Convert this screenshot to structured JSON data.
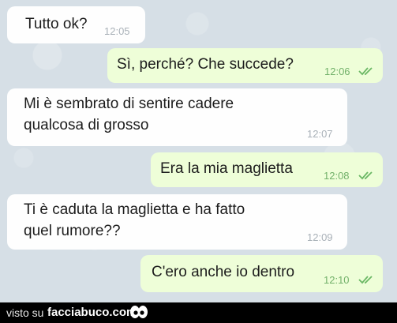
{
  "messages": [
    {
      "type": "incoming",
      "lines": [
        "Tutto ok?"
      ],
      "time": "12:05"
    },
    {
      "type": "outgoing",
      "lines": [
        "Sì, perché? Che succede?"
      ],
      "time": "12:06",
      "read_icon": "double-check-icon"
    },
    {
      "type": "incoming",
      "lines": [
        "Mi è sembrato di sentire cadere",
        "qualcosa di grosso"
      ],
      "time": "12:07"
    },
    {
      "type": "outgoing",
      "lines": [
        "Era la mia maglietta"
      ],
      "time": "12:08",
      "read_icon": "double-check-icon"
    },
    {
      "type": "incoming",
      "lines": [
        "Ti è caduta la maglietta e ha fatto",
        "quel rumore??"
      ],
      "time": "12:09"
    },
    {
      "type": "outgoing",
      "lines": [
        "C'ero anche io dentro"
      ],
      "time": "12:10",
      "read_icon": "double-check-icon"
    }
  ],
  "footer": {
    "prefix": "visto su",
    "site": "facciabuco.com",
    "logo_icon": "eyes-icon"
  },
  "colors": {
    "chat_background": "#d6dfe6",
    "incoming_bubble": "#fefefe",
    "outgoing_bubble": "#eefed8",
    "outgoing_time": "#72b16a",
    "incoming_time": "#a9b1b8",
    "footer_background": "#000000"
  }
}
